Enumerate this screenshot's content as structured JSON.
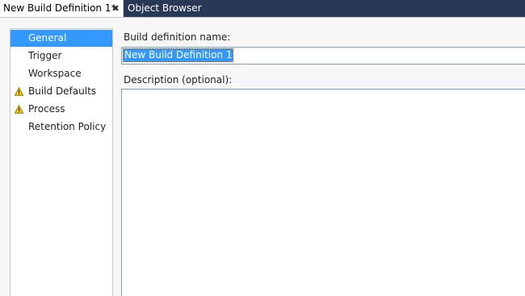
{
  "tabs": {
    "active": {
      "label": "New Build Definition 1*",
      "close_glyph": "✖"
    },
    "inactive": {
      "label": "Object Browser"
    }
  },
  "nav": {
    "items": [
      {
        "label": "General",
        "selected": true,
        "warning": false
      },
      {
        "label": "Trigger",
        "selected": false,
        "warning": false
      },
      {
        "label": "Workspace",
        "selected": false,
        "warning": false
      },
      {
        "label": "Build Defaults",
        "selected": false,
        "warning": true
      },
      {
        "label": "Process",
        "selected": false,
        "warning": true
      },
      {
        "label": "Retention Policy",
        "selected": false,
        "warning": false
      }
    ]
  },
  "form": {
    "name_label": "Build definition name:",
    "name_value": "New Build Definition 1",
    "description_label": "Description (optional):",
    "description_value": ""
  },
  "colors": {
    "tab_strip": "#293955",
    "selection": "#3399ff",
    "warning_icon": "#f2c500"
  }
}
